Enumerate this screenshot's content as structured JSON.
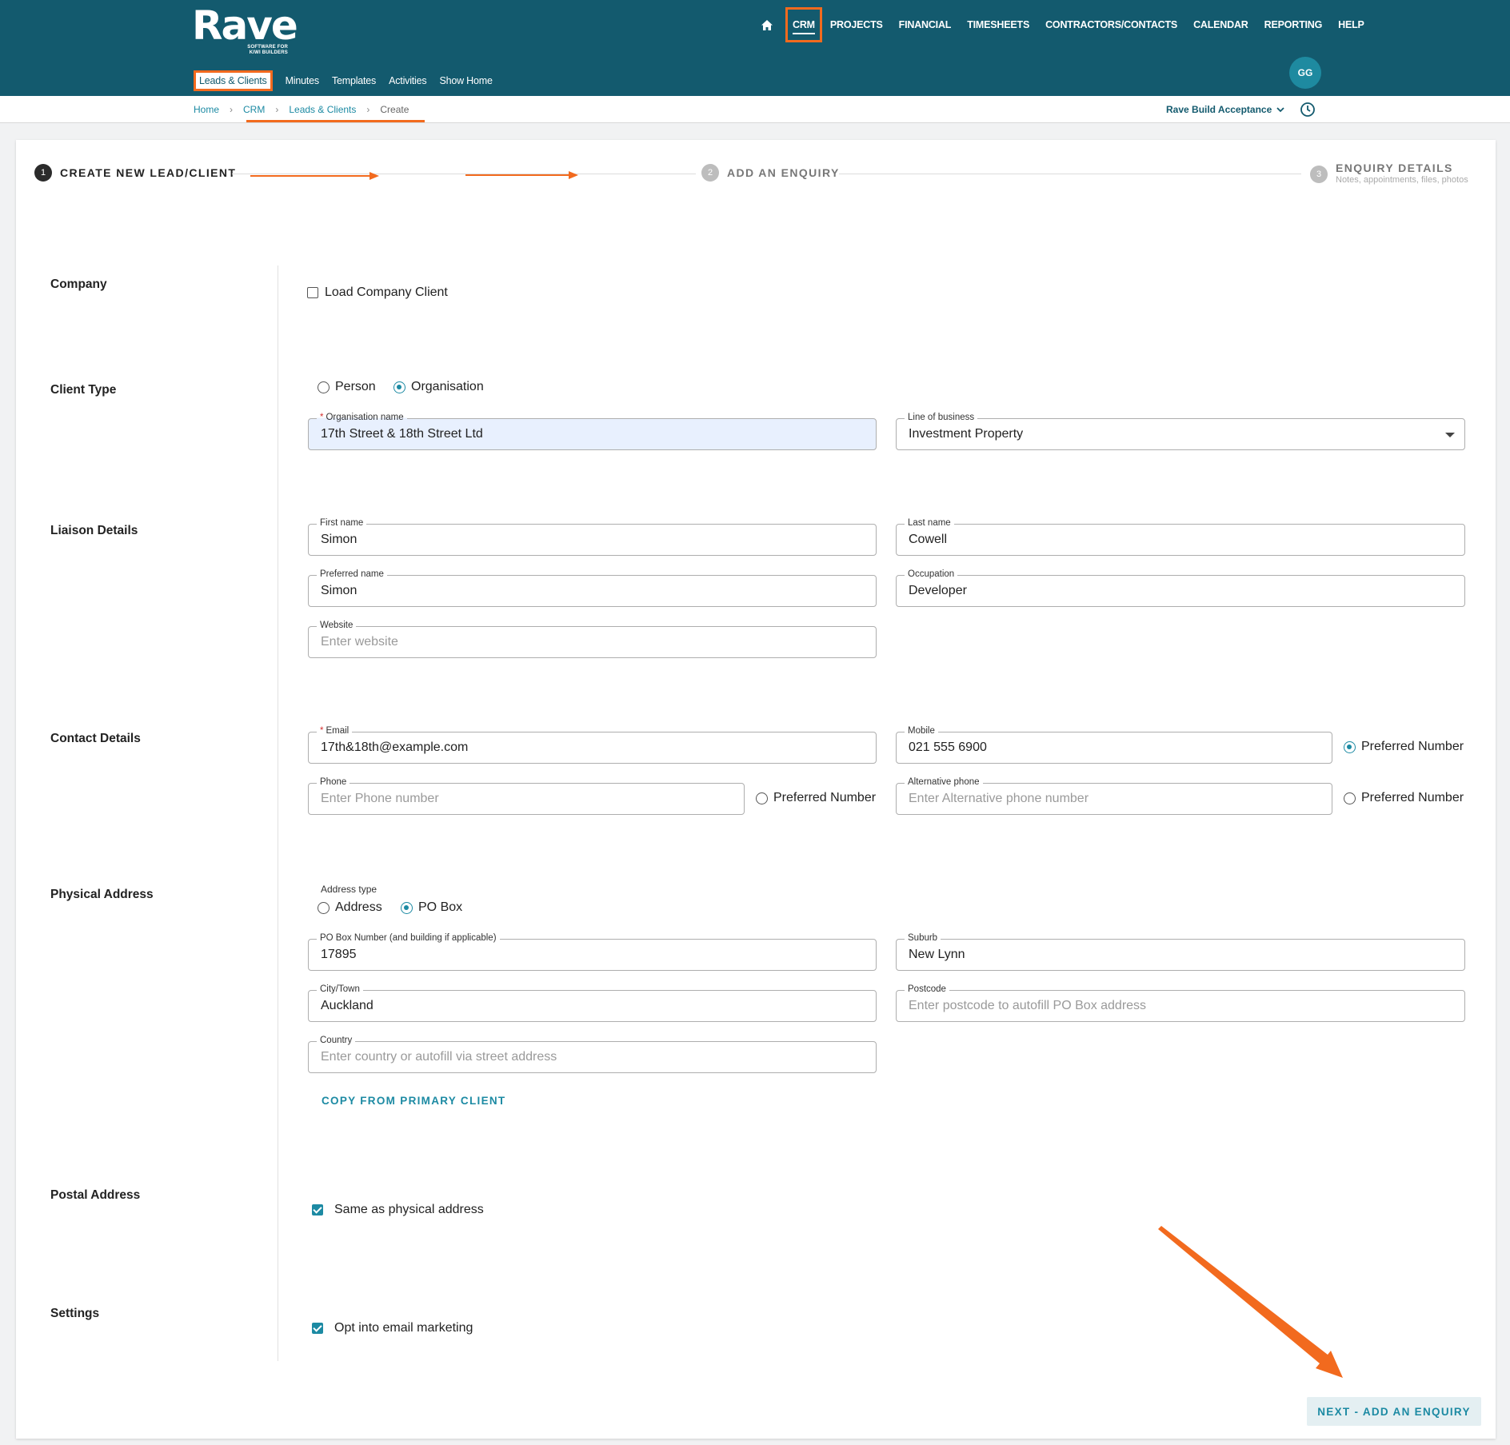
{
  "brand": {
    "name": "Rave",
    "tagline_1": "SOFTWARE FOR",
    "tagline_2": "KIWI BUILDERS"
  },
  "main_nav": [
    "CRM",
    "PROJECTS",
    "FINANCIAL",
    "TIMESHEETS",
    "CONTRACTORS/CONTACTS",
    "CALENDAR",
    "REPORTING",
    "HELP"
  ],
  "sub_nav": [
    "Leads & Clients",
    "Minutes",
    "Templates",
    "Activities",
    "Show Home"
  ],
  "user": {
    "initials": "GG"
  },
  "breadcrumb": [
    "Home",
    "CRM",
    "Leads & Clients",
    "Create"
  ],
  "tenant": "Rave Build Acceptance",
  "stepper": {
    "step1": {
      "num": "1",
      "label": "CREATE NEW LEAD/CLIENT"
    },
    "step2": {
      "num": "2",
      "label": "ADD AN ENQUIRY"
    },
    "step3": {
      "num": "3",
      "label": "ENQUIRY DETAILS",
      "sub": "Notes, appointments, files, photos"
    }
  },
  "sections": {
    "company": "Company",
    "client_type": "Client Type",
    "liaison": "Liaison Details",
    "contact": "Contact Details",
    "physical": "Physical Address",
    "postal": "Postal Address",
    "settings": "Settings"
  },
  "company": {
    "load_label": "Load Company Client",
    "checked": false
  },
  "client_type": {
    "options": [
      "Person",
      "Organisation"
    ],
    "selected": "Organisation",
    "org_name_label": "Organisation name",
    "org_name_value": "17th Street & 18th Street Ltd",
    "line_of_business_label": "Line of business",
    "line_of_business_value": "Investment Property"
  },
  "liaison": {
    "first_name_label": "First name",
    "first_name_value": "Simon",
    "last_name_label": "Last name",
    "last_name_value": "Cowell",
    "preferred_name_label": "Preferred name",
    "preferred_name_value": "Simon",
    "occupation_label": "Occupation",
    "occupation_value": "Developer",
    "website_label": "Website",
    "website_placeholder": "Enter website"
  },
  "contact": {
    "email_label": "Email",
    "email_value": "17th&18th@example.com",
    "mobile_label": "Mobile",
    "mobile_value": "021 555 6900",
    "phone_label": "Phone",
    "phone_placeholder": "Enter Phone number",
    "alt_phone_label": "Alternative phone",
    "alt_phone_placeholder": "Enter Alternative phone number",
    "preferred_label": "Preferred Number",
    "preferred_selected": "mobile"
  },
  "physical": {
    "address_type_label": "Address type",
    "address_type_options": [
      "Address",
      "PO Box"
    ],
    "address_type_selected": "PO Box",
    "po_box_label": "PO Box Number (and building if applicable)",
    "po_box_value": "17895",
    "suburb_label": "Suburb",
    "suburb_value": "New Lynn",
    "city_label": "City/Town",
    "city_value": "Auckland",
    "postcode_label": "Postcode",
    "postcode_placeholder": "Enter postcode to autofill PO Box address",
    "country_label": "Country",
    "country_placeholder": "Enter country or autofill via street address",
    "copy_button": "COPY FROM PRIMARY CLIENT"
  },
  "postal": {
    "same_label": "Same as physical address",
    "checked": true
  },
  "settings": {
    "marketing_label": "Opt into email marketing",
    "checked": true
  },
  "next_button": "NEXT - ADD AN ENQUIRY",
  "colors": {
    "header": "#135a6e",
    "accent": "#1c8aa3",
    "annotation": "#f26a1e"
  }
}
